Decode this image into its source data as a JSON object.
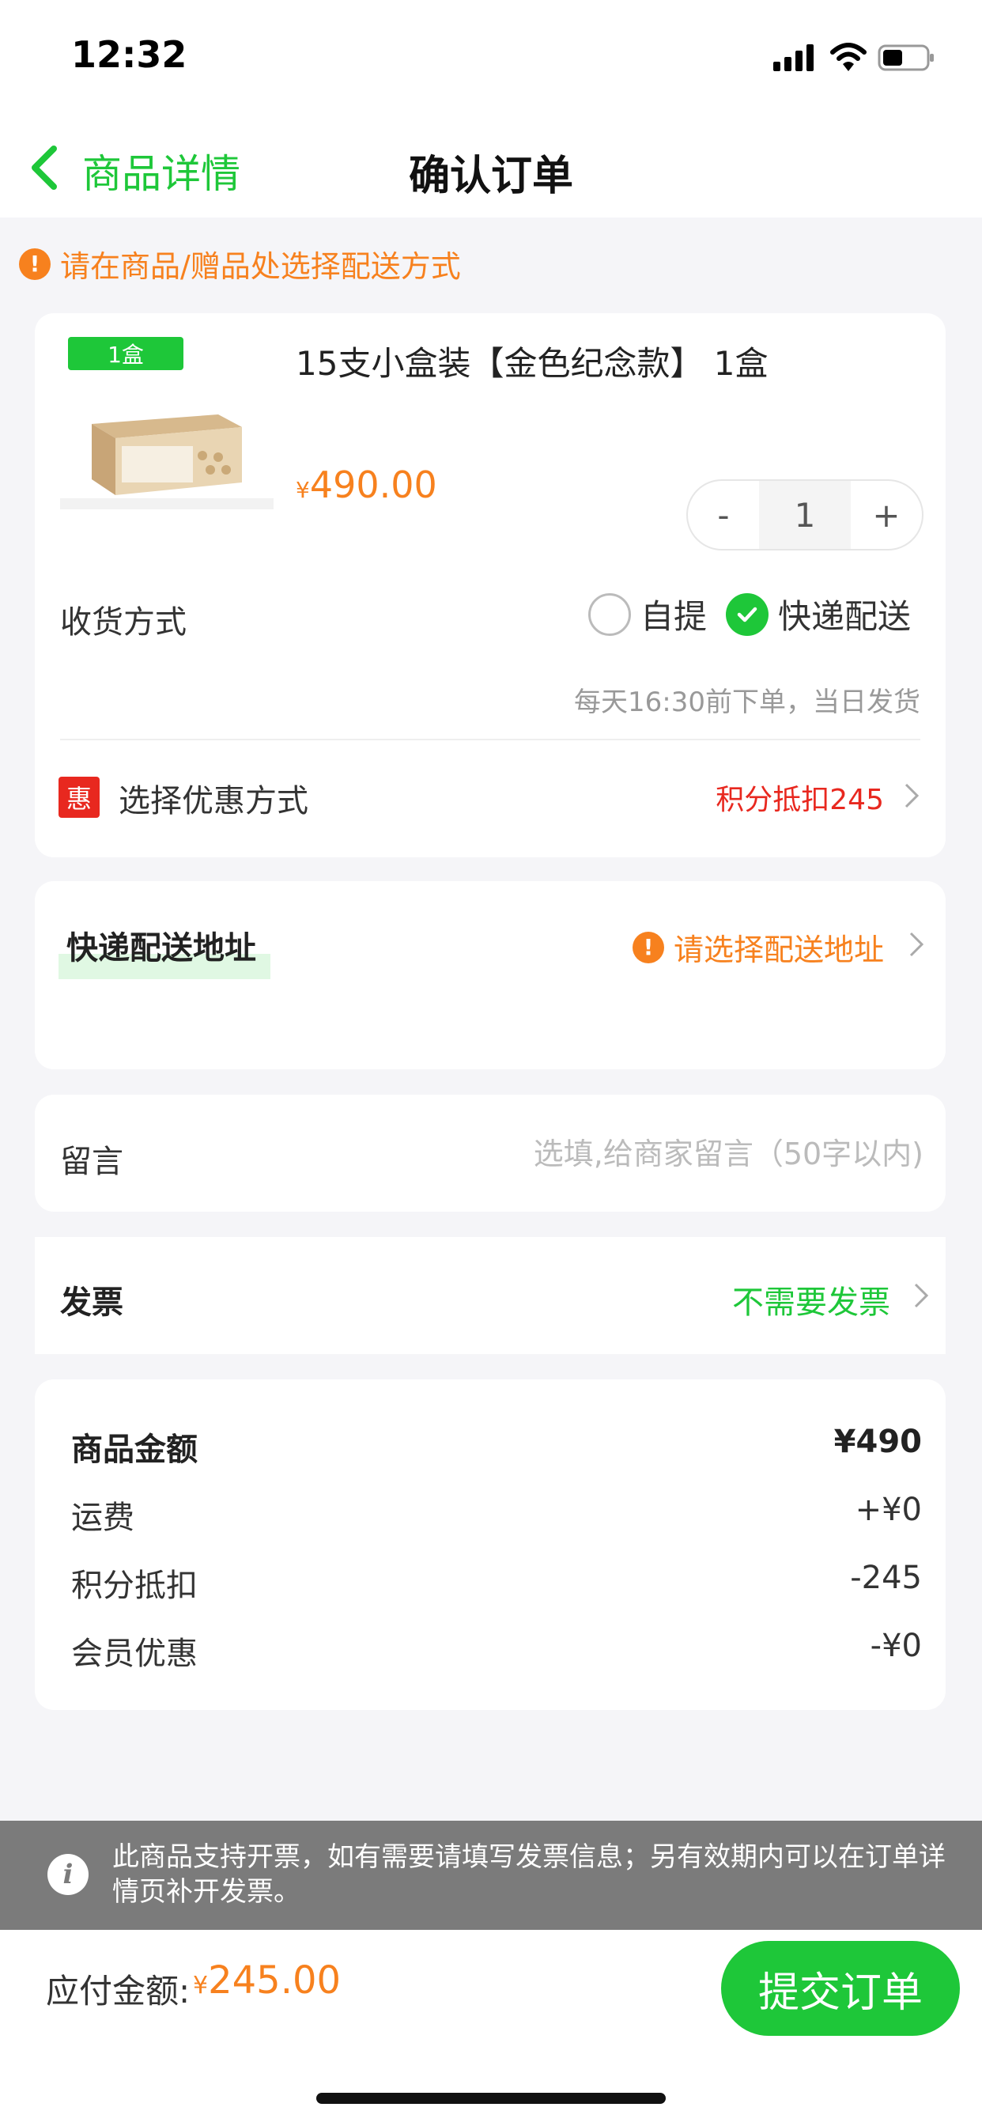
{
  "status_bar": {
    "time": "12:32"
  },
  "nav": {
    "back_label": "商品详情",
    "title": "确认订单"
  },
  "warning": {
    "text": "请在商品/赠品处选择配送方式"
  },
  "product": {
    "qty_tag": "1盒",
    "name": "15支小盒装【金色纪念款】 1盒",
    "price_symbol": "¥",
    "price": "490.00",
    "quantity": "1",
    "minus": "-",
    "plus": "+"
  },
  "shipping": {
    "label": "收货方式",
    "option_self": "自提",
    "option_express": "快递配送",
    "selected": "快递配送",
    "note": "每天16:30前下单，当日发货"
  },
  "promo": {
    "icon_text": "惠",
    "label": "选择优惠方式",
    "value": "积分抵扣245"
  },
  "address": {
    "title": "快递配送地址",
    "warning": "请选择配送地址"
  },
  "message": {
    "label": "留言",
    "placeholder": "选填,给商家留言（50字以内)",
    "value": ""
  },
  "invoice": {
    "label": "发票",
    "value": "不需要发票"
  },
  "summary": {
    "rows": [
      {
        "label": "商品金额",
        "value": "¥490"
      },
      {
        "label": "运费",
        "value": "+¥0"
      },
      {
        "label": "积分抵扣",
        "value": "-245"
      },
      {
        "label": "会员优惠",
        "value": "-¥0"
      }
    ]
  },
  "tip": {
    "text": "此商品支持开票，如有需要请填写发票信息；另有效期内可以在订单详情页补开发票。"
  },
  "footer": {
    "pay_label": "应付金额:",
    "pay_symbol": "¥",
    "pay_amount": "245.00",
    "submit_label": "提交订单"
  },
  "colors": {
    "brand_green": "#1ec739",
    "warn_orange": "#f7811e",
    "promo_red": "#e8281f",
    "tip_gray": "#7b7b7b"
  }
}
